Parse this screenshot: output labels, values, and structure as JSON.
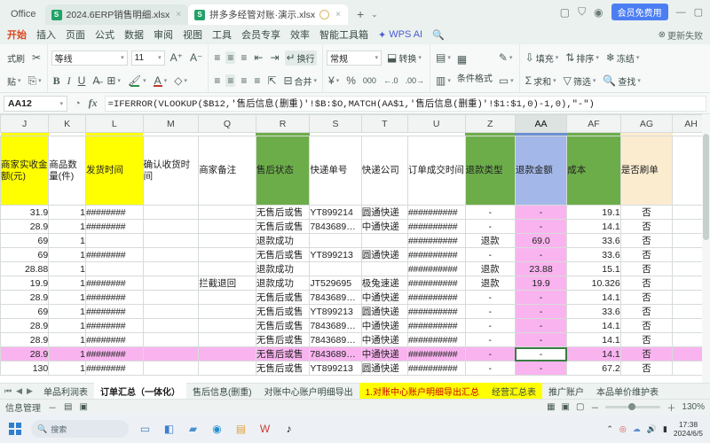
{
  "titlebar": {
    "office_label": "Office",
    "tabs": [
      {
        "name": "2024.6ERP销售明细.xlsx",
        "active": false,
        "icon": "xlsx-icon"
      },
      {
        "name": "拼多多经管对账·演示.xlsx",
        "active": true,
        "icon": "xlsx-icon"
      }
    ],
    "new_tab": "+",
    "tab_menu": "⌄",
    "right_icons": [
      "window-icon",
      "shield-icon",
      "avatar-icon"
    ],
    "vip_button": "会员免费用",
    "window_controls": [
      "minimize-icon",
      "maximize-icon",
      "close-icon"
    ]
  },
  "menubar": {
    "items": [
      "开始",
      "插入",
      "页面",
      "公式",
      "数据",
      "审阅",
      "视图",
      "工具",
      "会员专享",
      "效率",
      "智能工具箱"
    ],
    "active": "开始",
    "wps_ai": "WPS AI",
    "search_icon": "search-icon",
    "update_status": "更新失败"
  },
  "ribbon": {
    "clipboard": {
      "format_painter": "式刷",
      "cut": "剪切",
      "paste": "粘贴",
      "copy": "复制"
    },
    "font": {
      "family": "等线",
      "size": "11",
      "grow": "A",
      "shrink": "A",
      "bold": "B",
      "italic": "I",
      "underline": "U",
      "strikethrough": "A",
      "border": "田",
      "fill": "填充色",
      "font_color": "字体颜色",
      "clear": "清除"
    },
    "align": {
      "wrap": "换行",
      "merge": "合并"
    },
    "number": {
      "format": "常规",
      "convert": "转换",
      "currency": "¥",
      "percent": "%",
      "comma": "000",
      "inc_dec": "增加小数",
      "dec_dec": "减少小数"
    },
    "styles": {
      "conditional": "条件格式",
      "cell_style": "表格样式"
    },
    "editing": {
      "fill": "填充",
      "sum": "求和",
      "sort": "排序",
      "filter": "筛选",
      "freeze": "冻结",
      "find": "查找"
    }
  },
  "formula_bar": {
    "name_box": "AA12",
    "formula": "=IFERROR(VLOOKUP($B12,'售后信息(删重)'!$B:$O,MATCH(AA$1,'售后信息(删重)'!$1:$1,0)-1,0),\"-\")",
    "insert_function_icon": "fx-icon",
    "history_icon": "history-icon"
  },
  "sheet": {
    "columns": [
      {
        "letter": "J",
        "width": 52,
        "accent": "#ffff00",
        "selected": false
      },
      {
        "letter": "K",
        "width": 40,
        "accent": "",
        "selected": false
      },
      {
        "letter": "L",
        "width": 62,
        "accent": "#ffff00",
        "selected": false
      },
      {
        "letter": "M",
        "width": 60,
        "accent": "",
        "selected": false
      },
      {
        "letter": "Q",
        "width": 62,
        "accent": "",
        "selected": false
      },
      {
        "letter": "R",
        "width": 58,
        "accent": "#6cad4a",
        "selected": false
      },
      {
        "letter": "S",
        "width": 56,
        "accent": "",
        "selected": false
      },
      {
        "letter": "T",
        "width": 50,
        "accent": "",
        "selected": false
      },
      {
        "letter": "U",
        "width": 62,
        "accent": "",
        "selected": false
      },
      {
        "letter": "Z",
        "width": 54,
        "accent": "#6cad4a",
        "selected": false
      },
      {
        "letter": "AA",
        "width": 56,
        "accent": "#6b8fd4",
        "selected": true
      },
      {
        "letter": "AF",
        "width": 58,
        "accent": "#6cad4a",
        "selected": false
      },
      {
        "letter": "AG",
        "width": 56,
        "accent": "#fbecd0",
        "selected": false
      },
      {
        "letter": "AH",
        "width": 40,
        "accent": "",
        "selected": false
      }
    ],
    "headers": [
      {
        "text": "商家实收金额(元)",
        "fill": "y"
      },
      {
        "text": "商品数量(件)",
        "fill": "w"
      },
      {
        "text": "发货时间",
        "fill": "y"
      },
      {
        "text": "确认收货时间",
        "fill": "w"
      },
      {
        "text": "商家备注",
        "fill": "w"
      },
      {
        "text": "售后状态",
        "fill": "g"
      },
      {
        "text": "快递单号",
        "fill": "w"
      },
      {
        "text": "快递公司",
        "fill": "w"
      },
      {
        "text": "订单成交时间",
        "fill": "w"
      },
      {
        "text": "退款类型",
        "fill": "g"
      },
      {
        "text": "退款金额",
        "fill": "bl"
      },
      {
        "text": "成本",
        "fill": "g"
      },
      {
        "text": "是否刷单",
        "fill": "cr"
      },
      {
        "text": "",
        "fill": "w"
      }
    ],
    "rows": [
      {
        "highlight": false,
        "cells": [
          "31.9",
          "1",
          "########",
          "",
          "",
          "无售后或售",
          "YT899214",
          "圆通快递",
          "##########",
          "-",
          "-",
          "19.1",
          "否",
          ""
        ]
      },
      {
        "highlight": false,
        "cells": [
          "28.9",
          "1",
          "########",
          "",
          "",
          "无售后或售",
          "7843689…",
          "中通快递",
          "##########",
          "-",
          "-",
          "14.1",
          "否",
          ""
        ]
      },
      {
        "highlight": false,
        "cells": [
          "69",
          "1",
          "",
          "",
          "",
          "退款成功",
          "",
          "",
          "##########",
          "退款",
          "69.0",
          "33.6",
          "否",
          ""
        ]
      },
      {
        "highlight": false,
        "cells": [
          "69",
          "1",
          "########",
          "",
          "",
          "无售后或售",
          "YT899213",
          "圆通快递",
          "##########",
          "-",
          "-",
          "33.6",
          "否",
          ""
        ]
      },
      {
        "highlight": false,
        "cells": [
          "28.88",
          "1",
          "",
          "",
          "",
          "退款成功",
          "",
          "",
          "##########",
          "退款",
          "23.88",
          "15.1",
          "否",
          ""
        ]
      },
      {
        "highlight": false,
        "cells": [
          "19.9",
          "1",
          "########",
          "",
          "拦截退回",
          "退款成功",
          "JT529695",
          "极兔速递",
          "##########",
          "退款",
          "19.9",
          "10.326",
          "否",
          ""
        ]
      },
      {
        "highlight": false,
        "cells": [
          "28.9",
          "1",
          "########",
          "",
          "",
          "无售后或售",
          "7843689…",
          "中通快递",
          "##########",
          "-",
          "-",
          "14.1",
          "否",
          ""
        ]
      },
      {
        "highlight": false,
        "cells": [
          "69",
          "1",
          "########",
          "",
          "",
          "无售后或售",
          "YT899213",
          "圆通快递",
          "##########",
          "-",
          "-",
          "33.6",
          "否",
          ""
        ]
      },
      {
        "highlight": false,
        "cells": [
          "28.9",
          "1",
          "########",
          "",
          "",
          "无售后或售",
          "7843689…",
          "中通快递",
          "##########",
          "-",
          "-",
          "14.1",
          "否",
          ""
        ]
      },
      {
        "highlight": false,
        "cells": [
          "28.9",
          "1",
          "########",
          "",
          "",
          "无售后或售",
          "7843689…",
          "中通快递",
          "##########",
          "-",
          "-",
          "14.1",
          "否",
          ""
        ]
      },
      {
        "highlight": true,
        "cells": [
          "28.9",
          "1",
          "########",
          "",
          "",
          "无售后或售",
          "7843689…",
          "中通快递",
          "##########",
          "-",
          "-",
          "14.1",
          "否",
          ""
        ]
      },
      {
        "highlight": false,
        "cells": [
          "130",
          "1",
          "########",
          "",
          "",
          "无售后或售",
          "YT899213",
          "圆通快递",
          "##########",
          "-",
          "-",
          "67.2",
          "否",
          ""
        ]
      }
    ],
    "selected_cell_column_index": 10,
    "selected_cell_row_index": 10
  },
  "sheet_tabs": {
    "nav": [
      "⏮",
      "◀",
      "▶",
      "⏭"
    ],
    "tabs": [
      {
        "label": "单品利润表",
        "style": "normal"
      },
      {
        "label": "订单汇总（一体化）",
        "style": "active"
      },
      {
        "label": "售后信息(删重)",
        "style": "normal"
      },
      {
        "label": "对账中心账户明细导出",
        "style": "normal"
      },
      {
        "label": "1.对账中心账户明细导出汇总",
        "style": "hl"
      },
      {
        "label": "经营汇总表",
        "style": "hl2"
      },
      {
        "label": "推广账户",
        "style": "normal"
      },
      {
        "label": "本品单价维护表",
        "style": "normal"
      }
    ]
  },
  "statusbar": {
    "left": "信息管理",
    "icons": [
      "minus-icon",
      "notes-icon",
      "clipboard-icon"
    ],
    "view_icons": [
      "normal-view-icon",
      "page-view-icon",
      "preview-icon"
    ],
    "zoom": "130%",
    "zoom_out": "－",
    "zoom_in": "＋"
  },
  "taskbar": {
    "search_placeholder": "搜索",
    "icons": [
      "windows-start-icon",
      "search-icon",
      "taskview-icon",
      "widgets-icon",
      "chat-icon",
      "edge-icon",
      "explorer-icon",
      "wps-icon",
      "douyin-icon"
    ],
    "tray": [
      "chevron-up-icon",
      "qq-icon",
      "cloud-icon",
      "volume-icon",
      "network-icon"
    ],
    "clock_time": "17:38",
    "clock_date": "2024/6/5"
  }
}
